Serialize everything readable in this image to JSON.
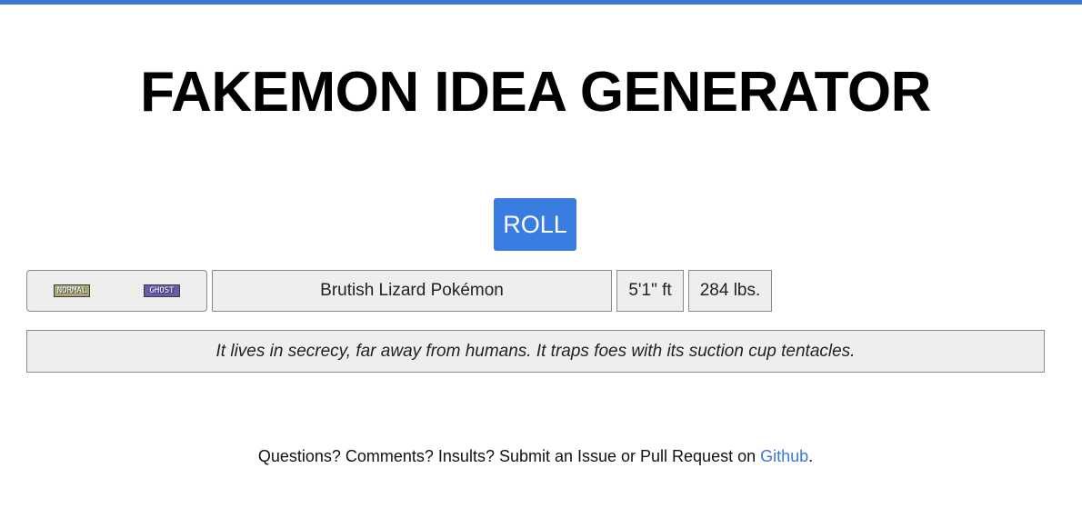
{
  "page": {
    "title": "FAKEMON IDEA GENERATOR",
    "accent_color": "#3a78d6"
  },
  "controls": {
    "roll_label": "ROLL",
    "roll_color": "#3a7de0"
  },
  "pokemon": {
    "types": [
      {
        "label": "NORMAL",
        "color": "#a8a77a"
      },
      {
        "label": "GHOST",
        "color": "#6c5aa8"
      }
    ],
    "species": "Brutish Lizard Pokémon",
    "height": "5'1\" ft",
    "weight": "284 lbs.",
    "description": "It lives in secrecy, far away from humans. It traps foes with its suction cup tentacles."
  },
  "footer": {
    "text_before": "Questions? Comments? Insults? Submit an Issue or Pull Request on ",
    "link_label": "Github",
    "text_after": "."
  }
}
